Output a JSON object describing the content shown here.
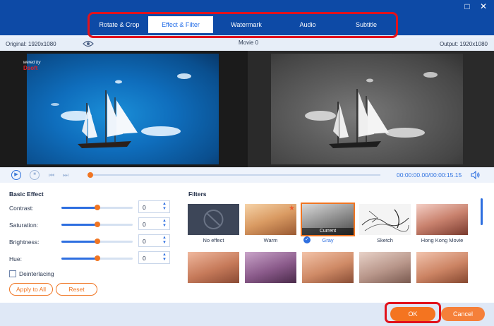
{
  "window": {
    "maximize_icon": "maximize-icon",
    "close_icon": "close-icon"
  },
  "tabs": [
    {
      "label": "Rotate & Crop",
      "active": false
    },
    {
      "label": "Effect & Filter",
      "active": true
    },
    {
      "label": "Watermark",
      "active": false
    },
    {
      "label": "Audio",
      "active": false
    },
    {
      "label": "Subtitle",
      "active": false
    }
  ],
  "info": {
    "original": "Original: 1920x1080",
    "movie": "Movie 0",
    "output": "Output: 1920x1080"
  },
  "preview": {
    "watermark_text": "wered by",
    "watermark_brand": "Dsoft"
  },
  "playback": {
    "time": "00:00:00.00/00:00:15.15",
    "progress": 0.0
  },
  "basic_effect": {
    "title": "Basic Effect",
    "rows": [
      {
        "label": "Contrast:",
        "value": "0",
        "level": 0.5
      },
      {
        "label": "Saturation:",
        "value": "0",
        "level": 0.5
      },
      {
        "label": "Brightness:",
        "value": "0",
        "level": 0.5
      },
      {
        "label": "Hue:",
        "value": "0",
        "level": 0.5
      }
    ],
    "deinterlacing_label": "Deinterlacing",
    "deinterlacing_checked": false,
    "apply_all_label": "Apply to All",
    "reset_label": "Reset"
  },
  "filters": {
    "title": "Filters",
    "current_tag": "Current",
    "items": [
      {
        "label": "No effect"
      },
      {
        "label": "Warm"
      },
      {
        "label": "Gray",
        "selected": true
      },
      {
        "label": "Sketch"
      },
      {
        "label": "Hong Kong Movie"
      }
    ]
  },
  "footer": {
    "ok_label": "OK",
    "cancel_label": "Cancel"
  },
  "colors": {
    "brand_blue": "#0d4aa6",
    "accent_orange": "#f47420",
    "highlight_red": "#e1121c"
  }
}
